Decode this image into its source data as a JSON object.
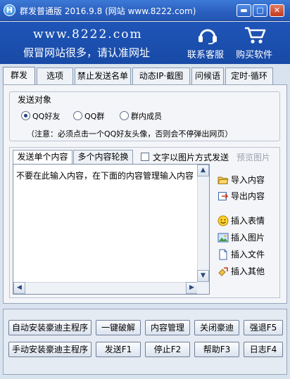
{
  "window": {
    "app_icon_letter": "H",
    "title": "群发普通版 2016.9.8  (网站 www.8222.com)",
    "minimize_glyph": "▬",
    "maximize_glyph": "□",
    "close_glyph": "✕"
  },
  "banner": {
    "url": "www.8222.com",
    "slogan": "假冒网站很多，请认准网址",
    "service_label": "联系客服",
    "buy_label": "购买软件",
    "icons": [
      "headset-icon",
      "cart-icon"
    ]
  },
  "tabs": [
    {
      "label": "群发",
      "active": true
    },
    {
      "label": "选项",
      "active": false
    },
    {
      "label": "禁止发送名单",
      "active": false
    },
    {
      "label": "动态IP·截图",
      "active": false
    },
    {
      "label": "问候语",
      "active": false
    },
    {
      "label": "定时·循环",
      "active": false
    }
  ],
  "send_target": {
    "title": "发送对象",
    "options": [
      {
        "label": "QQ好友",
        "selected": true
      },
      {
        "label": "QQ群",
        "selected": false
      },
      {
        "label": "群内成员",
        "selected": false
      }
    ],
    "note": "（注意：必须点击一个QQ好友头像，否则会不停弹出网页）"
  },
  "content": {
    "subtabs": [
      {
        "label": "发送单个内容",
        "active": true
      },
      {
        "label": "多个内容轮换",
        "active": false
      }
    ],
    "image_mode_label": "文字以图片方式发送",
    "image_mode_checked": false,
    "preview_label": "预览图片",
    "editor_text": "不要在此输入内容，在下面的内容管理输入内容",
    "side_actions": [
      {
        "label": "导入内容",
        "icon": "folder-open-icon"
      },
      {
        "label": "导出内容",
        "icon": "export-icon"
      },
      {
        "label": "插入表情",
        "icon": "smiley-icon"
      },
      {
        "label": "插入图片",
        "icon": "picture-icon"
      },
      {
        "label": "插入文件",
        "icon": "file-icon"
      },
      {
        "label": "插入其他",
        "icon": "other-icon"
      }
    ]
  },
  "buttons": {
    "row1": [
      "自动安装豪迪主程序",
      "一键破解",
      "内容管理",
      "关闭豪迪",
      "强退F5"
    ],
    "row2": [
      "手动安装豪迪主程序",
      "发送F1",
      "停止F2",
      "帮助F3",
      "日志F4"
    ]
  },
  "colors": {
    "title_bar": "#2a5fbf",
    "banner": "#1f55b8",
    "panel": "#f4f5f8",
    "window_bg": "#d9e3ef"
  }
}
